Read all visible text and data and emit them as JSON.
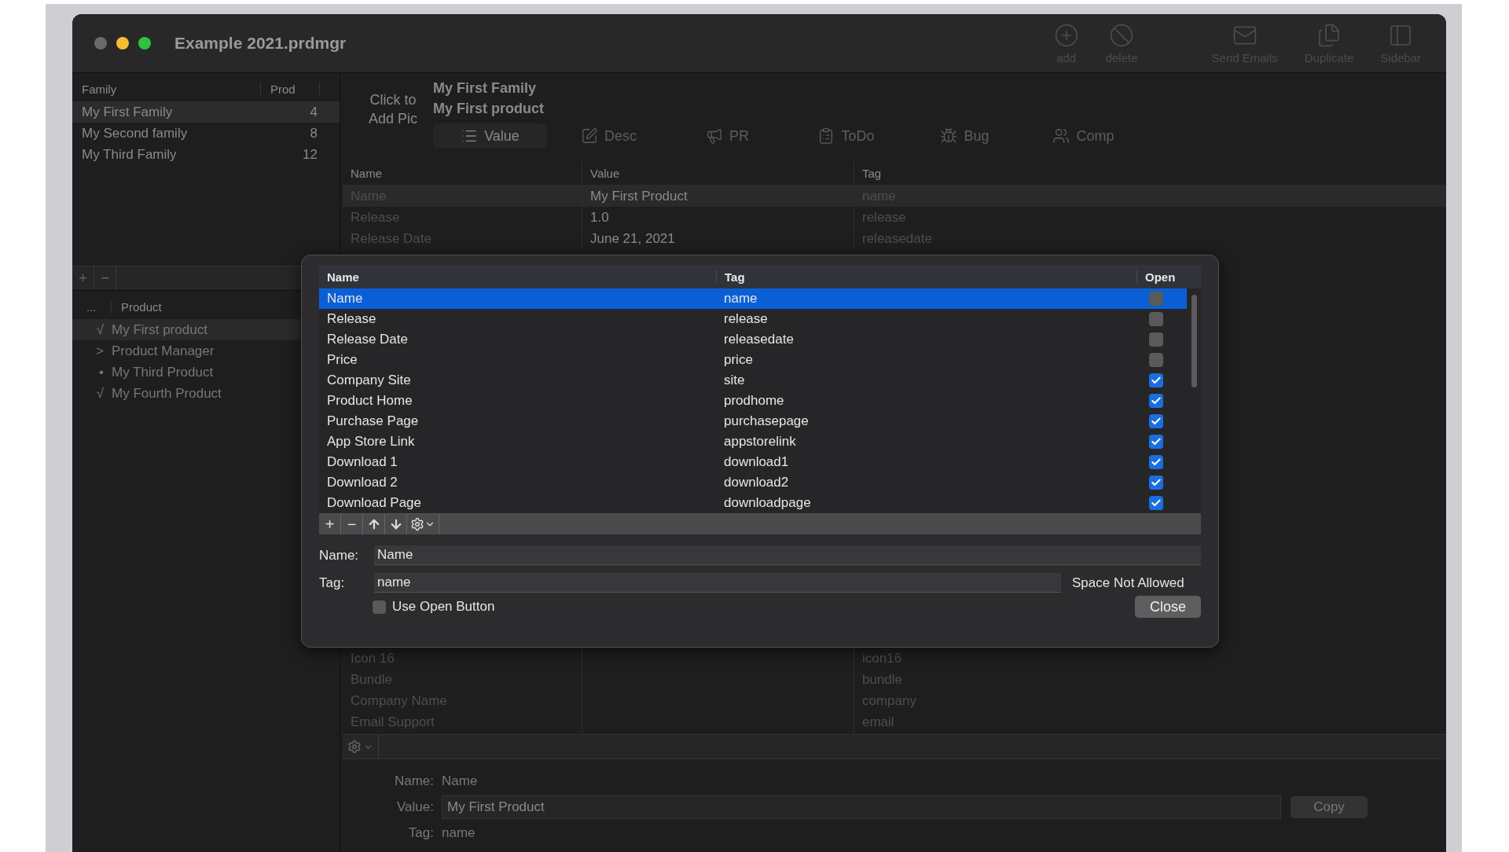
{
  "window": {
    "title": "Example 2021.prdmgr"
  },
  "toolbar": [
    {
      "label": "add"
    },
    {
      "label": "delete"
    },
    {
      "label": "Send Emails"
    },
    {
      "label": "Duplicate"
    },
    {
      "label": "Sidebar"
    }
  ],
  "families": {
    "columns": [
      "Family",
      "Prod"
    ],
    "rows": [
      {
        "name": "My First Family",
        "count": "4",
        "selected": true
      },
      {
        "name": "My Second family",
        "count": "8",
        "selected": false
      },
      {
        "name": "My Third Family",
        "count": "12",
        "selected": false
      }
    ],
    "buttons": [
      "+",
      "−"
    ]
  },
  "products": {
    "columns": [
      "...",
      "Product"
    ],
    "rows": [
      {
        "marker": "√",
        "name": "My First product",
        "selected": true
      },
      {
        "marker": ">",
        "name": "Product Manager",
        "selected": false
      },
      {
        "marker": "•",
        "name": "My Third Product",
        "selected": false
      },
      {
        "marker": "√",
        "name": "My Fourth Product",
        "selected": false
      }
    ]
  },
  "header": {
    "pic_label": "Click to Add Pic",
    "family": "My First Family",
    "product": "My First product"
  },
  "tabs": [
    {
      "label": "Value",
      "selected": true
    },
    {
      "label": "Desc",
      "selected": false
    },
    {
      "label": "PR",
      "selected": false
    },
    {
      "label": "ToDo",
      "selected": false
    },
    {
      "label": "Bug",
      "selected": false
    },
    {
      "label": "Comp",
      "selected": false
    }
  ],
  "fields_table": {
    "columns": [
      "Name",
      "Value",
      "Tag"
    ],
    "rows_top": [
      {
        "name": "Name",
        "value": "My First Product",
        "tag": "name",
        "selected": true
      },
      {
        "name": "Release",
        "value": "1.0",
        "tag": "release",
        "selected": false
      },
      {
        "name": "Release Date",
        "value": "June 21, 2021",
        "tag": "releasedate",
        "selected": false
      }
    ],
    "rows_bottom": [
      {
        "name": "Icon 16",
        "tag": "icon16",
        "selected": false
      },
      {
        "name": "Bundle",
        "tag": "bundle",
        "selected": false
      },
      {
        "name": "Company Name",
        "tag": "company",
        "selected": false
      },
      {
        "name": "Email Support",
        "tag": "email",
        "selected": false
      }
    ]
  },
  "detail": {
    "name_label": "Name:",
    "name": "Name",
    "value_label": "Value:",
    "value": "My First Product",
    "copy": "Copy",
    "tag_label": "Tag:",
    "tag": "name"
  },
  "dialog": {
    "columns": [
      "Name",
      "Tag",
      "Open"
    ],
    "rows": [
      {
        "name": "Name",
        "tag": "name",
        "open": false,
        "selected": true
      },
      {
        "name": "Release",
        "tag": "release",
        "open": false,
        "selected": false
      },
      {
        "name": "Release Date",
        "tag": "releasedate",
        "open": false,
        "selected": false
      },
      {
        "name": "Price",
        "tag": "price",
        "open": false,
        "selected": false
      },
      {
        "name": "Company Site",
        "tag": "site",
        "open": true,
        "selected": false
      },
      {
        "name": "Product Home",
        "tag": "prodhome",
        "open": true,
        "selected": false
      },
      {
        "name": "Purchase Page",
        "tag": "purchasepage",
        "open": true,
        "selected": false
      },
      {
        "name": "App Store Link",
        "tag": "appstorelink",
        "open": true,
        "selected": false
      },
      {
        "name": "Download 1",
        "tag": "download1",
        "open": true,
        "selected": false
      },
      {
        "name": "Download 2",
        "tag": "download2",
        "open": true,
        "selected": false
      },
      {
        "name": "Download Page",
        "tag": "downloadpage",
        "open": true,
        "selected": false
      }
    ],
    "tools": [
      {
        "kind": "text",
        "label": "+"
      },
      {
        "kind": "text",
        "label": "−"
      },
      {
        "kind": "up"
      },
      {
        "kind": "down"
      },
      {
        "kind": "gear"
      }
    ],
    "name_label": "Name:",
    "name_value": "Name",
    "tag_label": "Tag:",
    "tag_value": "name",
    "tag_hint": "Space Not Allowed",
    "use_open": {
      "label": "Use Open Button",
      "checked": false
    },
    "close": "Close"
  }
}
